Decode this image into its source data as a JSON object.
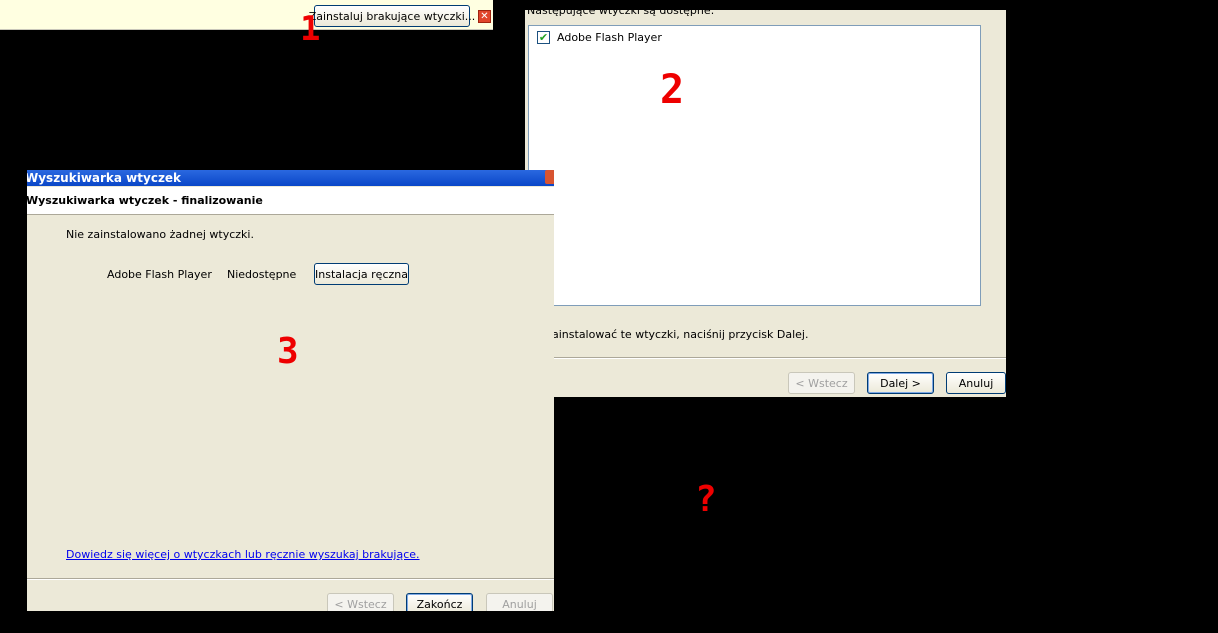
{
  "notification": {
    "install_button": "Zainstaluj brakujące wtyczki...",
    "close_icon": "close-icon",
    "marker": "1"
  },
  "dialog2": {
    "header": "Następujące wtyczki są dostępne:",
    "plugins": [
      {
        "label": "Adobe Flash Player",
        "checked": true
      }
    ],
    "marker": "2",
    "instruction": "ainstalować te wtyczki, naciśnij przycisk Dalej.",
    "buttons": {
      "back": "< Wstecz",
      "next": "Dalej >",
      "cancel": "Anuluj"
    }
  },
  "dialog3": {
    "title": "Wyszukiwarka wtyczek",
    "header_title": "Wyszukiwarka wtyczek - finalizowanie",
    "status_message": "Nie zainstalowano żadnej wtyczki.",
    "plugin_row": {
      "name": "Adobe Flash Player",
      "status": "Niedostępne",
      "action": "Instalacja ręczna"
    },
    "marker": "3",
    "link": "Dowiedz się więcej o wtyczkach lub ręcznie wyszukaj brakujące.",
    "buttons": {
      "back": "< Wstecz",
      "finish": "Zakończ",
      "cancel": "Anuluj"
    }
  },
  "question_marker": "?",
  "colors": {
    "background": "#000000",
    "dialog_bg": "#ece9d8",
    "notification_bg": "#ffffe1",
    "marker": "#e00000",
    "titlebar": "#0a47c8",
    "link": "#0000ee"
  }
}
